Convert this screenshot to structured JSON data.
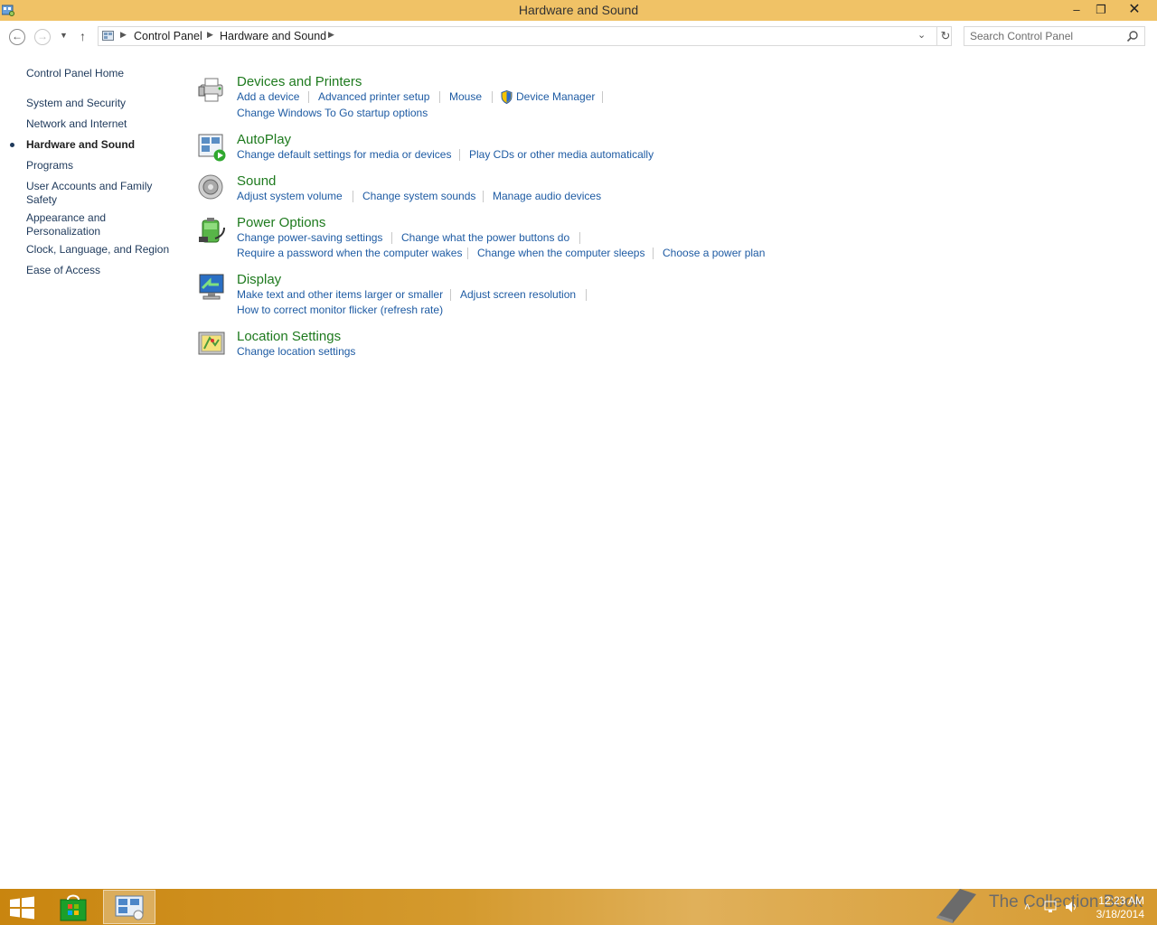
{
  "window": {
    "title": "Hardware and Sound",
    "minimize": "–",
    "restore": "❐",
    "close": "✕"
  },
  "nav": {
    "breadcrumb": [
      "Control Panel",
      "Hardware and Sound"
    ],
    "search_placeholder": "Search Control Panel"
  },
  "sidebar": {
    "home": "Control Panel Home",
    "items": [
      "System and Security",
      "Network and Internet",
      "Hardware and Sound",
      "Programs",
      "User Accounts and Family Safety",
      "Appearance and Personalization",
      "Clock, Language, and Region",
      "Ease of Access"
    ],
    "active_index": 2
  },
  "categories": {
    "devices": {
      "title": "Devices and Printers",
      "links": [
        "Add a device",
        "Advanced printer setup",
        "Mouse",
        "Device Manager",
        "Change Windows To Go startup options"
      ]
    },
    "autoplay": {
      "title": "AutoPlay",
      "links": [
        "Change default settings for media or devices",
        "Play CDs or other media automatically"
      ]
    },
    "sound": {
      "title": "Sound",
      "links": [
        "Adjust system volume",
        "Change system sounds",
        "Manage audio devices"
      ]
    },
    "power": {
      "title": "Power Options",
      "links": [
        "Change power-saving settings",
        "Change what the power buttons do",
        "Require a password when the computer wakes",
        "Change when the computer sleeps",
        "Choose a power plan"
      ]
    },
    "display": {
      "title": "Display",
      "links": [
        "Make text and other items larger or smaller",
        "Adjust screen resolution",
        "How to correct monitor flicker (refresh rate)"
      ]
    },
    "location": {
      "title": "Location Settings",
      "links": [
        "Change location settings"
      ]
    }
  },
  "taskbar": {
    "clock_time": "12:23 AM",
    "clock_date": "3/18/2014",
    "watermark": "The Collection Book"
  },
  "colors": {
    "titlebar": "#f0c266",
    "link": "#1e5ba3",
    "heading": "#1e7a1e",
    "taskbar": "#d49a2e"
  }
}
